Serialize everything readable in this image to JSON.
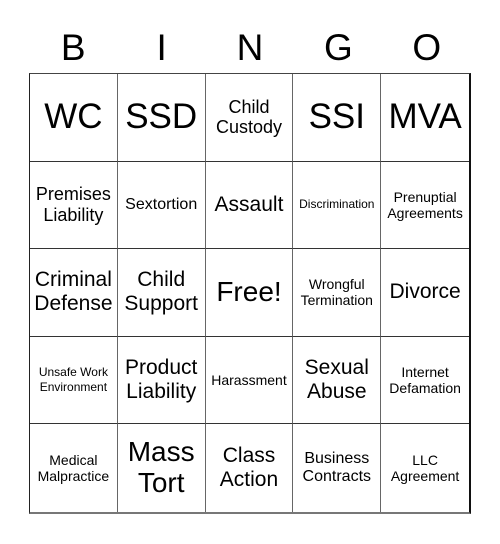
{
  "header": {
    "letters": [
      "B",
      "I",
      "N",
      "G",
      "O"
    ]
  },
  "cells": [
    {
      "text": "WC"
    },
    {
      "text": "SSD"
    },
    {
      "text": "Child Custody"
    },
    {
      "text": "SSI"
    },
    {
      "text": "MVA"
    },
    {
      "text": "Premises Liability"
    },
    {
      "text": "Sextortion"
    },
    {
      "text": "Assault"
    },
    {
      "text": "Discrimination"
    },
    {
      "text": "Prenuptial Agreements"
    },
    {
      "text": "Criminal Defense"
    },
    {
      "text": "Child Support"
    },
    {
      "text": "Free!"
    },
    {
      "text": "Wrongful Termination"
    },
    {
      "text": "Divorce"
    },
    {
      "text": "Unsafe Work Environment"
    },
    {
      "text": "Product Liability"
    },
    {
      "text": "Harassment"
    },
    {
      "text": "Sexual Abuse"
    },
    {
      "text": "Internet Defamation"
    },
    {
      "text": "Medical Malpractice"
    },
    {
      "text": "Mass Tort"
    },
    {
      "text": "Class Action"
    },
    {
      "text": "Business Contracts"
    },
    {
      "text": "LLC Agreement"
    }
  ]
}
